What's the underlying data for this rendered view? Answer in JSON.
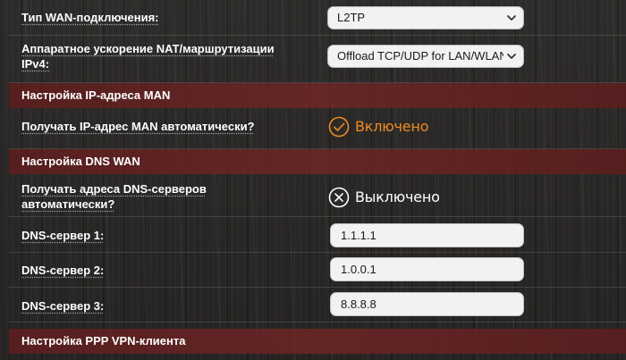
{
  "wan": {
    "type_label": "Тип WAN-подключения:",
    "type_value": "L2TP",
    "nat_label_line1": "Аппаратное ускорение NAT/маршрутизации",
    "nat_label_line2": "IPv4:",
    "nat_value": "Offload TCP/UDP for LAN/WLAN"
  },
  "ip_section": {
    "title": "Настройка IP-адреса MAN",
    "auto_label": "Получать IP-адрес MAN автоматически?",
    "auto_state": "Включено",
    "auto_icon": "check-circle-icon",
    "auto_color": "#f08a24"
  },
  "dns_section": {
    "title": "Настройка DNS WAN",
    "auto_label_line1": "Получать адреса DNS-серверов",
    "auto_label_line2": "автоматически?",
    "auto_state": "Выключено",
    "auto_icon": "x-circle-icon",
    "dns1_label": "DNS-сервер 1:",
    "dns1_value": "1.1.1.1",
    "dns2_label": "DNS-сервер 2:",
    "dns2_value": "1.0.0.1",
    "dns3_label": "DNS-сервер 3:",
    "dns3_value": "8.8.8.8"
  },
  "ppp_section": {
    "title": "Настройка PPP VPN-клиента"
  }
}
